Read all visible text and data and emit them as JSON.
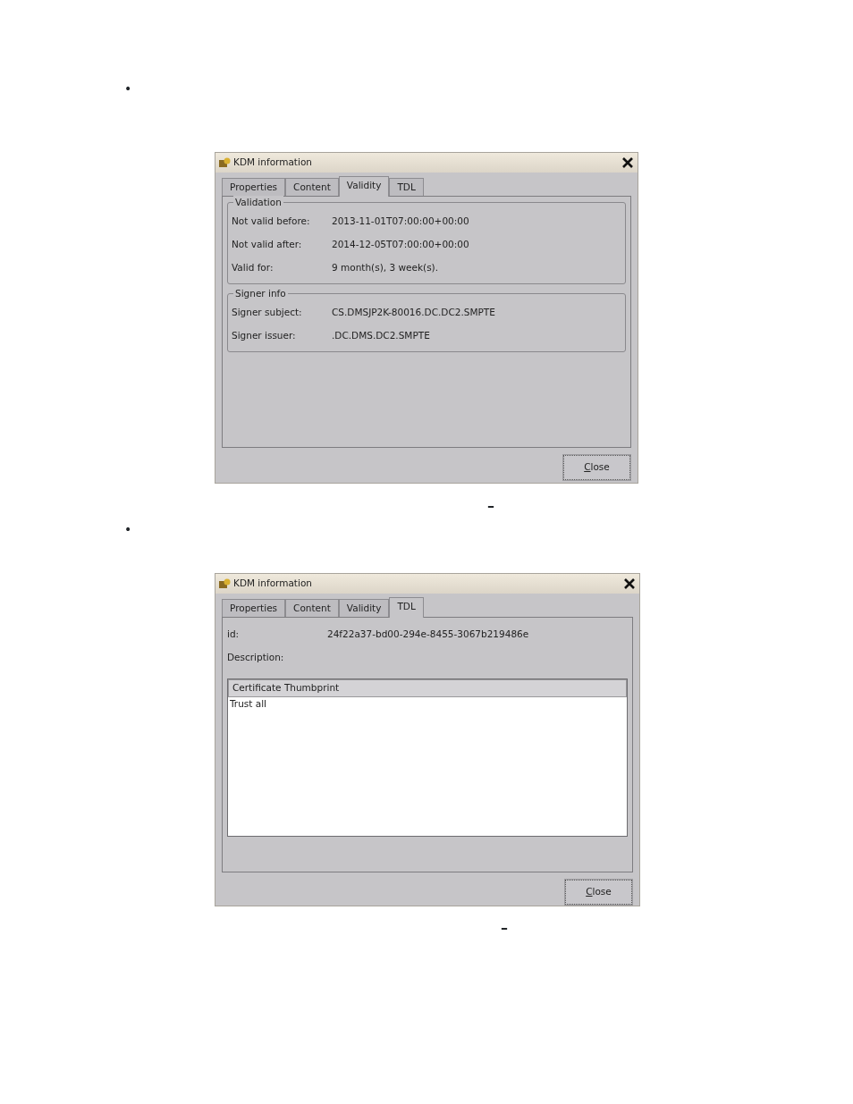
{
  "sections": [
    {
      "bullet": "•",
      "caption_mark": "–",
      "dialog": {
        "title": "KDM information",
        "tabs": [
          {
            "label": "Properties",
            "selected": false
          },
          {
            "label": "Content",
            "selected": false
          },
          {
            "label": "Validity",
            "selected": true
          },
          {
            "label": "TDL",
            "selected": false
          }
        ],
        "kind": "groups",
        "groups": [
          {
            "title": "Validation",
            "rows": [
              {
                "label": "Not valid before:",
                "value": "2013-11-01T07:00:00+00:00"
              },
              {
                "label": "Not valid after:",
                "value": "2014-12-05T07:00:00+00:00"
              },
              {
                "label": "Valid for:",
                "value": "9 month(s), 3 week(s)."
              }
            ]
          },
          {
            "title": "Signer info",
            "rows": [
              {
                "label": "Signer subject:",
                "value": "CS.DMSJP2K-80016.DC.DC2.SMPTE"
              },
              {
                "label": "Signer issuer:",
                "value": ".DC.DMS.DC2.SMPTE"
              }
            ]
          }
        ],
        "button": {
          "parts": [
            {
              "text": "C",
              "underline": true
            },
            {
              "text": "lose",
              "underline": false
            }
          ]
        }
      }
    },
    {
      "bullet": "•",
      "caption_mark": "–",
      "dialog": {
        "title": "KDM information",
        "tabs": [
          {
            "label": "Properties",
            "selected": false
          },
          {
            "label": "Content",
            "selected": false
          },
          {
            "label": "Validity",
            "selected": false
          },
          {
            "label": "TDL",
            "selected": true
          }
        ],
        "kind": "list",
        "fields": [
          {
            "label": "id:",
            "value": "24f22a37-bd00-294e-8455-3067b219486e"
          },
          {
            "label": "Description:"
          }
        ],
        "list": {
          "column": "Certificate Thumbprint",
          "rows": [
            "Trust all"
          ]
        },
        "button": {
          "parts": [
            {
              "text": "C",
              "underline": true
            },
            {
              "text": "lose",
              "underline": false
            }
          ]
        }
      }
    }
  ]
}
